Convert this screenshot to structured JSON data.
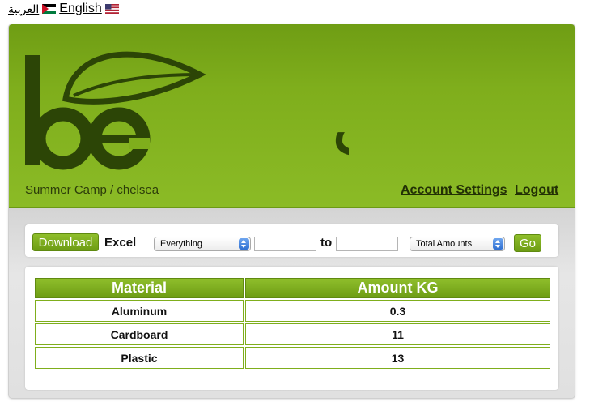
{
  "languages": [
    {
      "label": "العربية",
      "flag": "jordan-flag-icon"
    },
    {
      "label": "English",
      "flag": "us-flag-icon"
    }
  ],
  "header": {
    "logo_latin": "be",
    "logo_arabic": "بيئي",
    "breadcrumb": "Summer Camp / chelsea",
    "account_settings": "Account Settings",
    "logout": "Logout"
  },
  "toolbar": {
    "download_label": "Download",
    "excel_label": "Excel",
    "range_select_value": "Everything",
    "from_date": "",
    "to_label": "to",
    "to_date": "",
    "mode_select_value": "Total Amounts",
    "go_label": "Go"
  },
  "table": {
    "headers": [
      "Material",
      "Amount KG"
    ],
    "rows": [
      [
        "Aluminum",
        "0.3"
      ],
      [
        "Cardboard",
        "11"
      ],
      [
        "Plastic",
        "13"
      ]
    ]
  },
  "colors": {
    "brand_green": "#7fae1c",
    "logo_dark": "#2c4506"
  }
}
